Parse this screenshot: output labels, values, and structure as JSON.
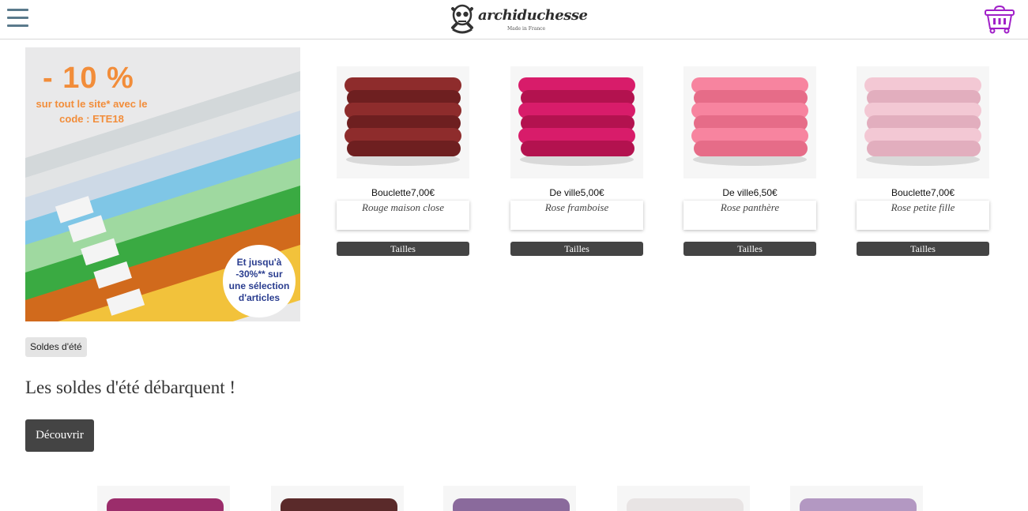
{
  "header": {
    "logo_text": "archiduchesse",
    "logo_sub": "Made in France"
  },
  "promo": {
    "percent": "- 10 %",
    "line1": "sur tout le site*  avec le",
    "line2": "code : ETE18",
    "circle_line1": "Et jusqu'à",
    "circle_line2": "-30%** sur",
    "circle_line3": "une sélection",
    "circle_line4": "d'articles",
    "stripe_colors": [
      "#d3d8da",
      "#e2e4e5",
      "#cdd9e6",
      "#7fc6e6",
      "#9fd9a0",
      "#3aaa42",
      "#d16a1c",
      "#f2c23b"
    ]
  },
  "tag": "Soldes d'été",
  "headline": "Les soldes d'été débarquent !",
  "discover_label": "Découvrir",
  "products": [
    {
      "title": "Bouclette7,00€",
      "color_name": "Rouge maison close",
      "button": "Tailles",
      "sock_color": "#8e2c2c",
      "sock_dark": "#6e1f20"
    },
    {
      "title": "De ville5,00€",
      "color_name": "Rose framboise",
      "button": "Tailles",
      "sock_color": "#d81c6a",
      "sock_dark": "#b3124f"
    },
    {
      "title": "De ville6,50€",
      "color_name": "Rose panthère",
      "button": "Tailles",
      "sock_color": "#f7849f",
      "sock_dark": "#e66c88"
    },
    {
      "title": "Bouclette7,00€",
      "color_name": "Rose petite fille",
      "button": "Tailles",
      "sock_color": "#f3c8d4",
      "sock_dark": "#e2aebe"
    }
  ],
  "bottom_thumbs": [
    {
      "sock_color": "#9b2d6b"
    },
    {
      "sock_color": "#5a2a2a"
    },
    {
      "sock_color": "#8a6a9c"
    },
    {
      "sock_color": "#e8e4e4"
    },
    {
      "sock_color": "#b398c2"
    }
  ],
  "icons": {
    "menu": "hamburger-icon",
    "cart": "basket-icon",
    "logo": "skull-logo-icon"
  },
  "colors": {
    "accent_orange": "#f28d3a",
    "button_dark": "#444444",
    "cart_purple": "#a020c8"
  }
}
